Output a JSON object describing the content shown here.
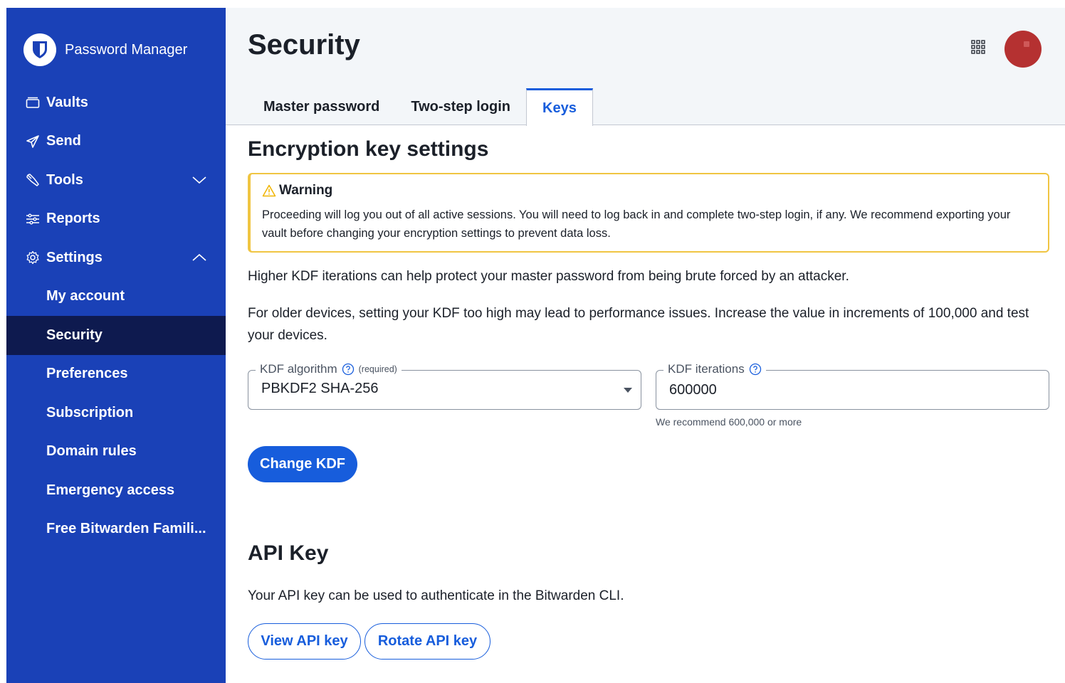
{
  "brand": {
    "name": "Password Manager"
  },
  "sidebar": {
    "items": [
      {
        "label": "Vaults",
        "icon": "vault-icon"
      },
      {
        "label": "Send",
        "icon": "send-icon"
      },
      {
        "label": "Tools",
        "icon": "wrench-icon",
        "expanded": false
      },
      {
        "label": "Reports",
        "icon": "reports-icon"
      },
      {
        "label": "Settings",
        "icon": "gear-icon",
        "expanded": true
      }
    ],
    "settings_children": [
      {
        "label": "My account"
      },
      {
        "label": "Security",
        "active": true
      },
      {
        "label": "Preferences"
      },
      {
        "label": "Subscription"
      },
      {
        "label": "Domain rules"
      },
      {
        "label": "Emergency access"
      },
      {
        "label": "Free Bitwarden Famili..."
      }
    ]
  },
  "header": {
    "title": "Security",
    "tabs": [
      {
        "label": "Master password"
      },
      {
        "label": "Two-step login"
      },
      {
        "label": "Keys",
        "active": true
      }
    ]
  },
  "encryption": {
    "heading": "Encryption key settings",
    "warning_title": "Warning",
    "warning_body": "Proceeding will log you out of all active sessions. You will need to log back in and complete two-step login, if any. We recommend exporting your vault before changing your encryption settings to prevent data loss.",
    "para1": "Higher KDF iterations can help protect your master password from being brute forced by an attacker.",
    "para2": "For older devices, setting your KDF too high may lead to performance issues. Increase the value in increments of 100,000 and test your devices.",
    "kdf_algorithm_label": "KDF algorithm",
    "kdf_algorithm_required": "(required)",
    "kdf_algorithm_value": "PBKDF2 SHA-256",
    "kdf_iterations_label": "KDF iterations",
    "kdf_iterations_value": "600000",
    "kdf_iterations_hint": "We recommend 600,000 or more",
    "change_button": "Change KDF"
  },
  "api": {
    "heading": "API Key",
    "description": "Your API key can be used to authenticate in the Bitwarden CLI.",
    "view_button": "View API key",
    "rotate_button": "Rotate API key"
  },
  "colors": {
    "sidebar_bg": "#1a41b7",
    "sidebar_active": "#0e1a4f",
    "primary": "#175ddc",
    "warning_border": "#f0c542",
    "avatar": "#b53131"
  }
}
